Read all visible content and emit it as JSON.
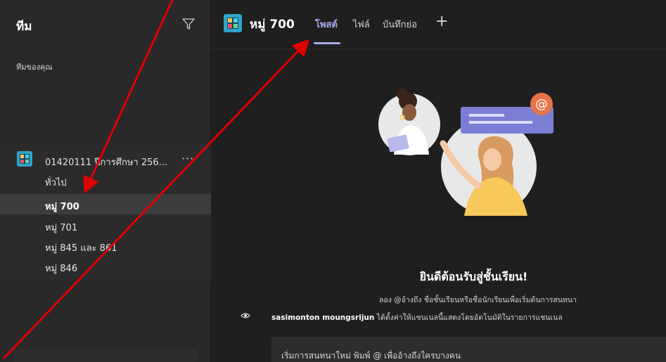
{
  "sidebar": {
    "title": "ทีม",
    "section_label": "ทีมของคุณ",
    "team": {
      "name": "01420111 ปีการศึกษา 256...",
      "more": "···"
    },
    "channels": [
      {
        "label": "ทั่วไป"
      },
      {
        "label": "หมู่ 700"
      },
      {
        "label": "หมู่ 701"
      },
      {
        "label": "หมู่ 845 และ 861"
      },
      {
        "label": "หมู่ 846"
      }
    ],
    "active_channel": "หมู่ 700"
  },
  "header": {
    "channel_title": "หมู่ 700",
    "tabs": [
      {
        "label": "โพสต์",
        "active": true
      },
      {
        "label": "ไฟล์",
        "active": false
      },
      {
        "label": "บันทึกย่อ",
        "active": false
      }
    ],
    "add_tab": "+"
  },
  "welcome": {
    "title": "ยินดีต้อนรับสู่ชั้นเรียน!",
    "subtitle": "ลอง @อ้างถึง ชื่อชั้นเรียนหรือชื่อนักเรียนเพื่อเริ่มต้นการสนทนา",
    "info_user": "sasimonton moungsrijun",
    "info_text": " ได้ตั้งค่าให้แชนเนลนี้แสดงโดยอัตโนมัติในรายการแชนเนล"
  },
  "compose": {
    "placeholder": "เริ่มการสนทนาใหม่ พิมพ์ @ เพื่ออ้างถึงใครบางคน"
  },
  "colors": {
    "accent": "#a9a9ee",
    "annotation": "#e00000",
    "team_icon": "#2fa4c8"
  },
  "icons": [
    "filter-icon",
    "team-icon",
    "more-icon",
    "eye-icon",
    "add-tab-icon",
    "welcome-illustration"
  ]
}
